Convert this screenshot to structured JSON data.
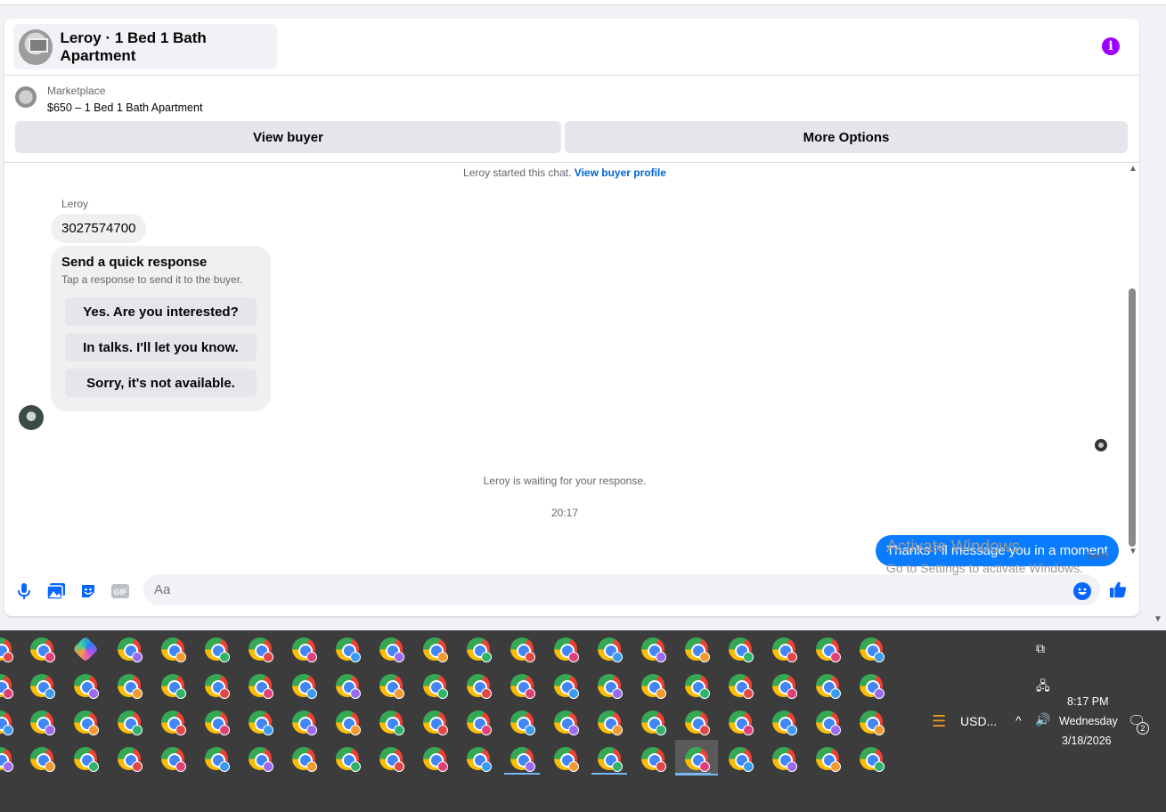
{
  "header": {
    "title": "Leroy · 1 Bed 1 Bath Apartment",
    "info_icon": "info-icon"
  },
  "listing": {
    "source": "Marketplace",
    "summary": "$650 – 1 Bed 1 Bath Apartment"
  },
  "actions": {
    "view_buyer": "View buyer",
    "more_options": "More Options"
  },
  "conversation": {
    "started_text": "Leroy started this chat.",
    "view_profile_link": "View buyer profile",
    "sender_name": "Leroy",
    "incoming_message": "3027574700",
    "quick_response": {
      "title": "Send a quick response",
      "subtitle": "Tap a response to send it to the buyer.",
      "options": [
        "Yes. Are you interested?",
        "In talks. I'll let you know.",
        "Sorry, it's not available."
      ]
    },
    "waiting_text": "Leroy is waiting for your response.",
    "timestamp": "20:17",
    "outgoing_message": "Thanks i\"il message you in a moment",
    "status": "Sent"
  },
  "composer": {
    "placeholder": "Aa",
    "icons": [
      "microphone-icon",
      "photo-icon",
      "sticker-icon",
      "gif-icon",
      "emoji-icon",
      "thumbs-up-icon"
    ],
    "gif_label": "GIF"
  },
  "watermark": {
    "line1": "Activate Windows",
    "line2": "Go to Settings to activate Windows."
  },
  "taskbar": {
    "time": "8:17 PM",
    "day": "Wednesday",
    "date": "3/18/2026",
    "currency": "USD...",
    "notification_count": "2",
    "colors": {
      "background": "#3c3c3c",
      "accent": "#7ab7f5"
    }
  },
  "colors": {
    "outgoing_bubble": "#0a7cff",
    "link": "#0064d1",
    "info": "#9d00ff",
    "button": "#e4e6eb"
  }
}
